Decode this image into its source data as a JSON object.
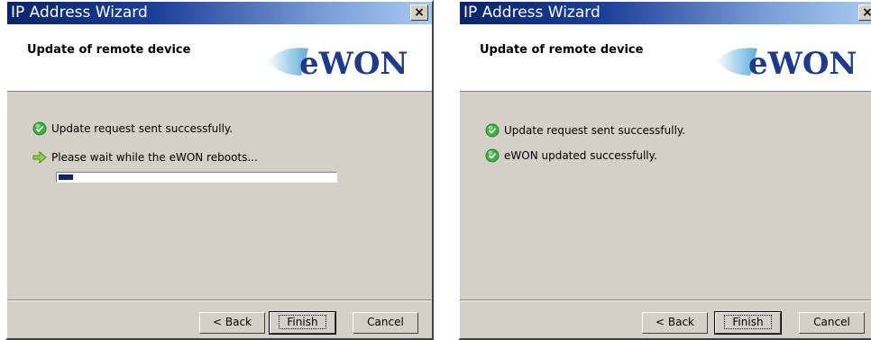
{
  "window1": {
    "title": "IP Address Wizard",
    "close_label": "×",
    "header_title": "Update of remote device",
    "logo_text": "eWON",
    "status1": "Update request sent successfully.",
    "status2": "Please wait while the eWON reboots...",
    "progress_percent": 5,
    "buttons": {
      "back": "< Back",
      "finish": "Finish",
      "cancel": "Cancel"
    }
  },
  "window2": {
    "title": "IP Address Wizard",
    "close_label": "×",
    "header_title": "Update of remote device",
    "logo_text": "eWON",
    "status1": "Update request sent successfully.",
    "status2": "eWON updated successfully.",
    "buttons": {
      "back": "< Back",
      "finish": "Finish",
      "cancel": "Cancel"
    }
  },
  "colors": {
    "title_bar_start": "#0a246a",
    "title_bar_end": "#a6caf0",
    "dialog_face": "#d4d0c8",
    "logo_blue": "#1e3a8a",
    "success_green": "#3cb043",
    "arrow_green": "#8fd14f"
  },
  "icons": {
    "success": "check-circle-icon",
    "pending": "right-arrow-icon",
    "close": "close-icon"
  }
}
